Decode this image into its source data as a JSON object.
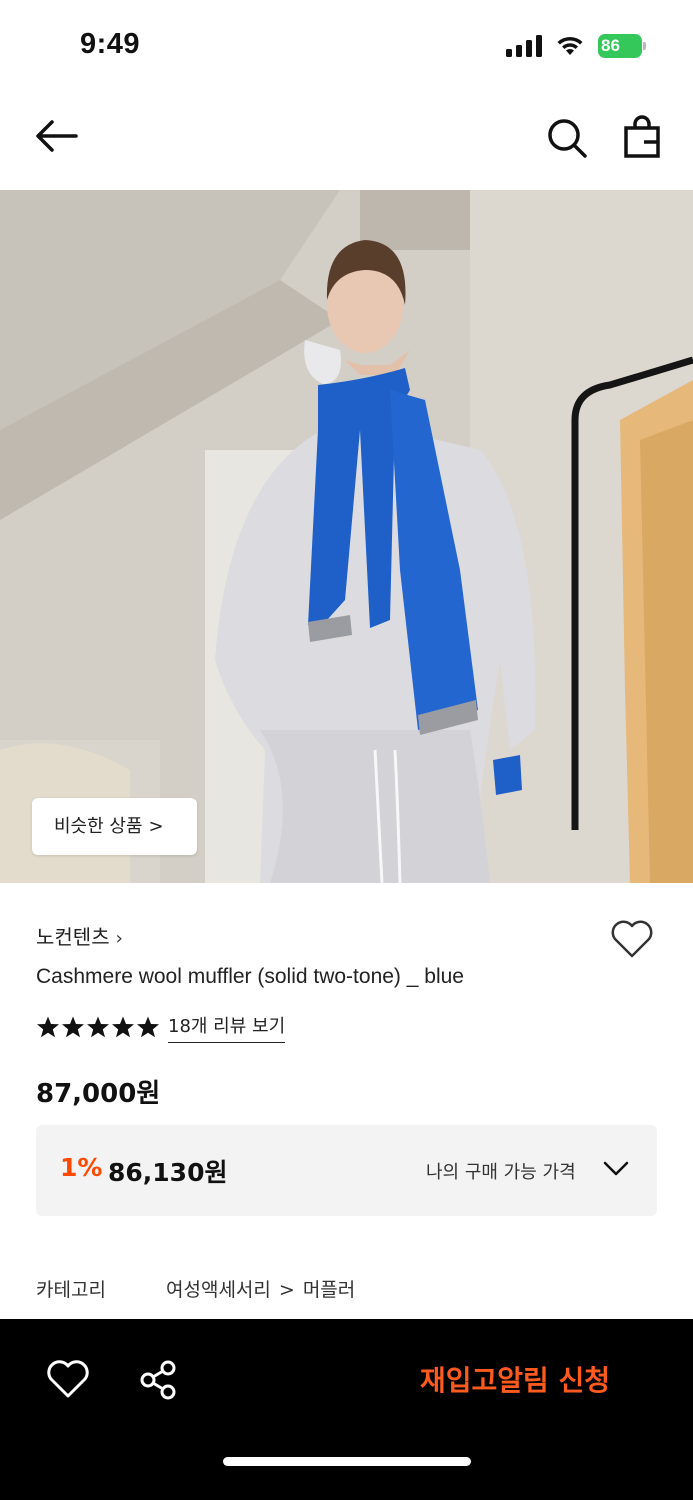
{
  "status_bar": {
    "time": "9:49",
    "battery": "86"
  },
  "product": {
    "similar_label": "비슷한 상품",
    "brand": "노컨텐츠",
    "title": "Cashmere wool muffler (solid two-tone) _ blue",
    "rating": 5,
    "review_link": "18개 리뷰 보기",
    "price": "87,000원",
    "discount": {
      "rate": "1%",
      "price": "86,130원",
      "label": "나의 구매 가능 가격"
    },
    "category": {
      "label": "카테고리",
      "path": [
        "여성액세서리",
        "머플러"
      ]
    }
  },
  "bottom_bar": {
    "cta": "재입고알림 신청"
  },
  "icons": {
    "chevron": "›",
    "chevron_small": ">"
  },
  "colors": {
    "accent": "#ff4800",
    "cta": "#ff5a1f",
    "battery": "#34c759"
  }
}
